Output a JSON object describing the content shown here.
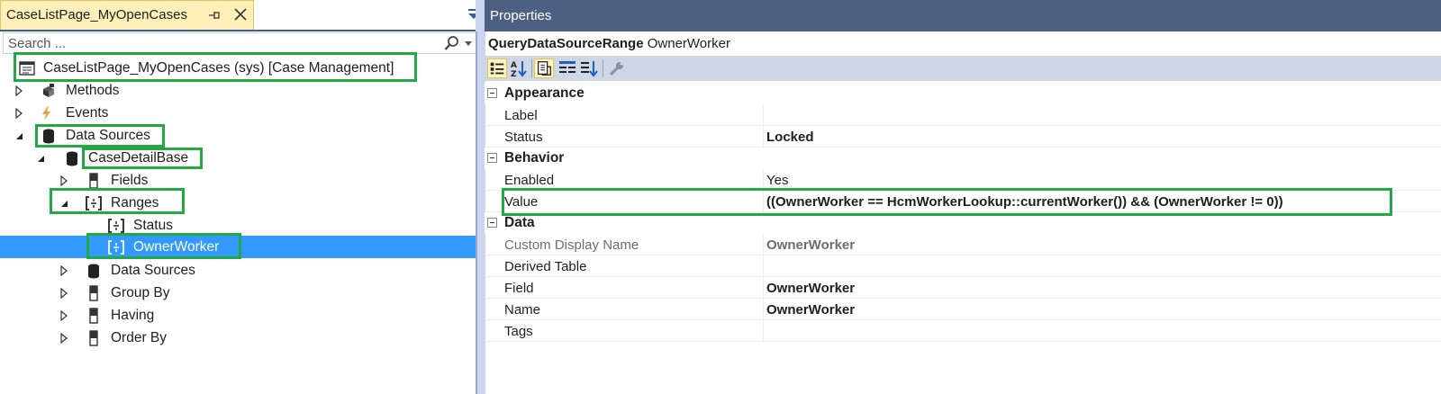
{
  "explorer": {
    "tab_title": "CaseListPage_MyOpenCases",
    "search_placeholder": "Search ...",
    "tree": {
      "root": "CaseListPage_MyOpenCases (sys) [Case Management]",
      "methods": "Methods",
      "events": "Events",
      "data_sources": "Data Sources",
      "case_detail_base": "CaseDetailBase",
      "fields": "Fields",
      "ranges": "Ranges",
      "status": "Status",
      "owner_worker": "OwnerWorker",
      "nested_data_sources": "Data Sources",
      "group_by": "Group By",
      "having": "Having",
      "order_by": "Order By"
    }
  },
  "properties": {
    "title": "Properties",
    "object_kind": "QueryDataSourceRange",
    "object_name": "OwnerWorker",
    "categories": {
      "appearance": "Appearance",
      "behavior": "Behavior",
      "data": "Data"
    },
    "rows": {
      "label": {
        "name": "Label",
        "value": ""
      },
      "status": {
        "name": "Status",
        "value": "Locked"
      },
      "enabled": {
        "name": "Enabled",
        "value": "Yes"
      },
      "value": {
        "name": "Value",
        "value": "((OwnerWorker == HcmWorkerLookup::currentWorker()) && (OwnerWorker != 0))"
      },
      "custom_display_name": {
        "name": "Custom Display Name",
        "value": "OwnerWorker"
      },
      "derived_table": {
        "name": "Derived Table",
        "value": ""
      },
      "field": {
        "name": "Field",
        "value": "OwnerWorker"
      },
      "name": {
        "name": "Name",
        "value": "OwnerWorker"
      },
      "tags": {
        "name": "Tags",
        "value": ""
      }
    }
  },
  "colors": {
    "highlight": "#22a845",
    "selection": "#3399ff",
    "title_bar": "#4d6082",
    "active_tab": "#fef0b8"
  }
}
